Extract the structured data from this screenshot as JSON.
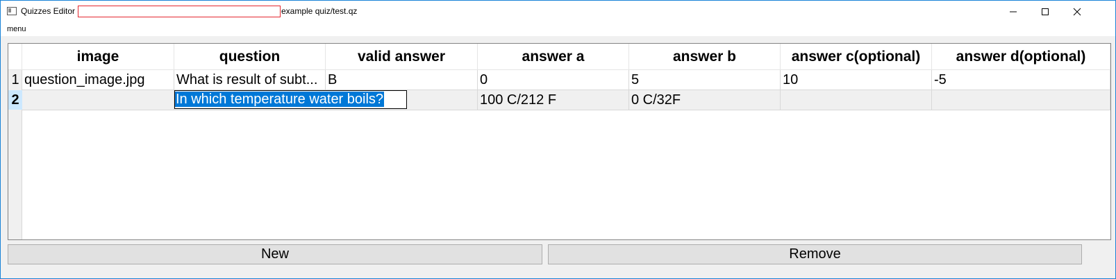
{
  "window": {
    "title_prefix": "Quizzes Editor -",
    "title_suffix": "example quiz/test.qz",
    "controls": {
      "minimize": "minimize",
      "maximize": "maximize",
      "close": "close"
    }
  },
  "menubar": {
    "menu_label": "menu"
  },
  "table": {
    "headers": [
      "image",
      "question",
      "valid answer",
      "answer a",
      "answer b",
      "answer c(optional)",
      "answer d(optional)"
    ],
    "rows": [
      {
        "number": "1",
        "cells": [
          "question_image.jpg",
          "What is result of subt...",
          "B",
          "0",
          "5",
          "10",
          "-5"
        ]
      },
      {
        "number": "2",
        "cells": [
          "",
          "",
          "",
          "100 C/212 F",
          "0 C/32F",
          "",
          ""
        ]
      }
    ],
    "editor": {
      "value": "In which temperature water boils?"
    }
  },
  "buttons": {
    "new_label": "New",
    "remove_label": "Remove"
  },
  "colors": {
    "selection": "#0078d7",
    "redaction_border": "#e4262e",
    "window_border": "#1883d7"
  }
}
